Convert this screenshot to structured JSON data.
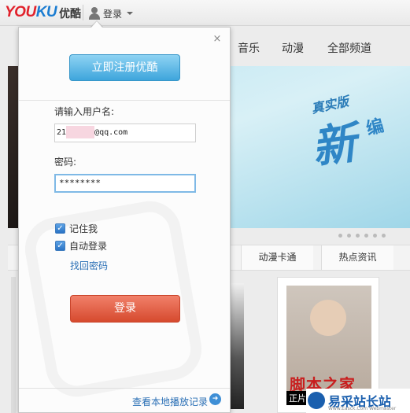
{
  "header": {
    "logo_you": "YOU",
    "logo_ku": "KU",
    "logo_cn": "优酷",
    "login_label": "登录"
  },
  "nav": {
    "items": [
      "音乐",
      "动漫",
      "全部频道"
    ]
  },
  "banner": {
    "title1": "真实版",
    "title2": "新",
    "title3": "编"
  },
  "tabs": [
    "动漫卡通",
    "热点资讯"
  ],
  "poster": {
    "title": "脚本之家",
    "badge": "正片"
  },
  "watermark": {
    "title": "易采站长站",
    "sub": "Www.Easck.Com Webmaster"
  },
  "login_popup": {
    "close": "×",
    "register_label": "立即注册优酷",
    "username_label": "请输入用户名:",
    "username_prefix": "21",
    "username_suffix": "@qq.com",
    "password_label": "密码:",
    "password_value": "********",
    "remember_label": "记住我",
    "auto_login_label": "自动登录",
    "forgot_label": "找回密码",
    "login_label": "登录",
    "local_history_label": "查看本地播放记录",
    "remember_checked": true,
    "auto_login_checked": true
  },
  "colors": {
    "register_button": "#3ea5dc",
    "login_button": "#d64a2e",
    "link": "#2a6fb5"
  }
}
